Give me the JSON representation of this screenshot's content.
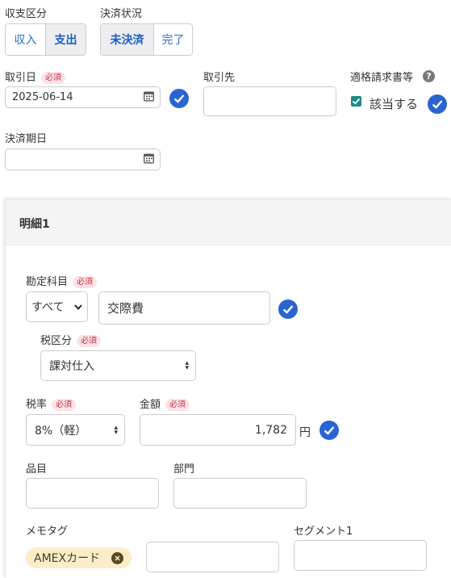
{
  "income_expense": {
    "label": "収支区分",
    "options": [
      "収入",
      "支出"
    ],
    "selected": 1
  },
  "settlement": {
    "label": "決済状況",
    "options": [
      "未決済",
      "完了"
    ],
    "selected": 0
  },
  "required_badge": "必須",
  "transaction_date": {
    "label": "取引日",
    "value": "2025-06-14"
  },
  "partner": {
    "label": "取引先",
    "value": ""
  },
  "qualified_invoice": {
    "label": "適格請求書等",
    "checkbox_label": "該当する",
    "checked": true
  },
  "due_date": {
    "label": "決済期日",
    "value": ""
  },
  "detail": {
    "title": "明細1",
    "account": {
      "label": "勘定科目",
      "filter": "すべて",
      "value": "交際費"
    },
    "tax_class": {
      "label": "税区分",
      "value": "課対仕入"
    },
    "tax_rate": {
      "label": "税率",
      "value": "8%（軽）"
    },
    "amount": {
      "label": "金額",
      "value": "1,782",
      "unit": "円"
    },
    "item": {
      "label": "品目",
      "value": ""
    },
    "department": {
      "label": "部門",
      "value": ""
    },
    "memo_tag": {
      "label": "メモタグ",
      "tag": "AMEXカード"
    },
    "segment": {
      "label": "セグメント1",
      "value": ""
    }
  },
  "colors": {
    "accent": "#2a63d4",
    "teal": "#1f8a83",
    "tag_bg": "#fbedc9",
    "tag_text": "#5a4a1e"
  }
}
